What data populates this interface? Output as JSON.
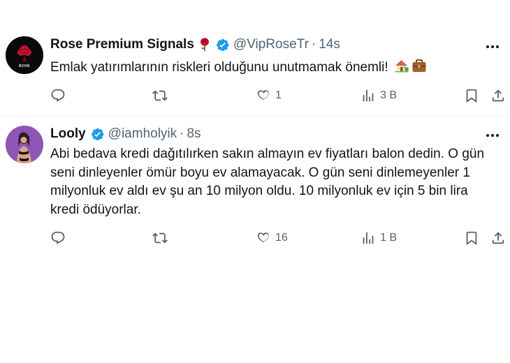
{
  "tweets": [
    {
      "name": "Rose Premium Signals",
      "name_emoji": "rose-emoji",
      "handle": "@VipRoseTr",
      "separator": "·",
      "time": "14s",
      "text": "Emlak yatırımlarının riskleri olduğunu unutmamak önemli!",
      "text_emojis": [
        "house-with-garden-emoji",
        "briefcase-emoji"
      ],
      "avatar_text": "ROSE",
      "replies": "",
      "retweets": "",
      "likes": "1",
      "views": "3 B"
    },
    {
      "name": "Looly",
      "handle": "@iamholyik",
      "separator": "·",
      "time": "8s",
      "text": "Abi bedava kredi dağıtılırken sakın almayın ev fiyatları balon dedin. O gün seni dinleyenler ömür boyu ev alamayacak. O gün seni dinlemeyenler  1 milyonluk ev aldı ev şu an 10 milyon oldu. 10 milyonluk ev için 5 bin lira kredi ödüyorlar.",
      "replies": "",
      "retweets": "",
      "likes": "16",
      "views": "1 B"
    }
  ],
  "colors": {
    "verified": "#1d9bf0",
    "text": "#0f1419",
    "secondary": "#536471",
    "divider": "#eff3f4",
    "rose": "#c8102e"
  }
}
